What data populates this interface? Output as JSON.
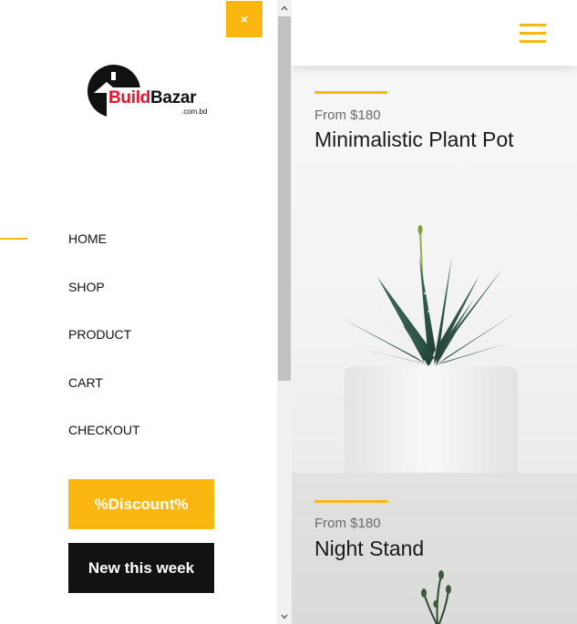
{
  "sidebar": {
    "close_label": "×",
    "logo": {
      "word1": "Build",
      "word2": "Bazar",
      "subtitle": ".com.bd"
    },
    "nav": [
      {
        "label": "HOME",
        "active": true
      },
      {
        "label": "SHOP",
        "active": false
      },
      {
        "label": "PRODUCT",
        "active": false
      },
      {
        "label": "CART",
        "active": false
      },
      {
        "label": "CHECKOUT",
        "active": false
      }
    ],
    "discount_label": "%Discount%",
    "new_label": "New this week"
  },
  "main": {
    "products": [
      {
        "price": "From $180",
        "name": "Minimalistic Plant Pot"
      },
      {
        "price": "From $180",
        "name": "Night Stand"
      }
    ]
  },
  "colors": {
    "accent": "#fbb710",
    "dark": "#131212",
    "logo_red": "#e8142a"
  },
  "icons": [
    "close-icon",
    "hamburger-menu-icon",
    "scroll-up-arrow-icon",
    "scroll-down-arrow-icon"
  ]
}
